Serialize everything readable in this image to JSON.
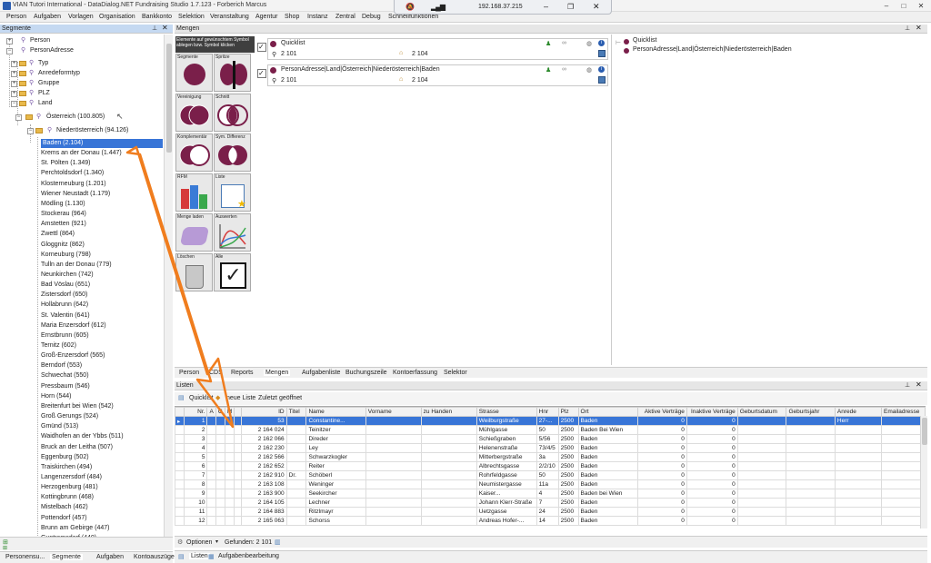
{
  "window": {
    "title": "VIAN Tutori International - DataDialog.NET Fundraising Studio 1.7.123 - Forberich Marcus"
  },
  "remote": {
    "ip": "192.168.37.215"
  },
  "menu": [
    "Person",
    "Aufgaben",
    "Vorlagen",
    "Organisation",
    "Bankkonto",
    "Selektion",
    "Veranstaltung",
    "Agentur",
    "Shop",
    "Instanz",
    "Zentral",
    "Debug",
    "Schnellfunktionen"
  ],
  "segmente": {
    "header": "Segmente",
    "root_items": [
      "Person",
      "PersonAdresse"
    ],
    "sub_items": [
      "Typ",
      "Anredeformtyp",
      "Gruppe",
      "PLZ",
      "Land"
    ],
    "country": "Österreich (100.805)",
    "state": "Niederösterreich (94.126)",
    "places": [
      "Baden (2.104)",
      "Krems an der Donau (1.447)",
      "St. Pölten (1.349)",
      "Perchtoldsdorf (1.340)",
      "Klosterneuburg (1.201)",
      "Wiener Neustadt (1.179)",
      "Mödling (1.130)",
      "Stockerau (964)",
      "Amstetten (921)",
      "Zwettl (864)",
      "Gloggnitz (862)",
      "Korneuburg (798)",
      "Tulln an der Donau (779)",
      "Neunkirchen (742)",
      "Bad Vöslau (651)",
      "Zistersdorf (650)",
      "Hollabrunn (642)",
      "St. Valentin (641)",
      "Maria Enzersdorf (612)",
      "Ernstbrunn (605)",
      "Ternitz (602)",
      "Groß-Enzersdorf (565)",
      "Berndorf (553)",
      "Schwechat (550)",
      "Pressbaum (546)",
      "Horn (544)",
      "Breitenfurt bei Wien (542)",
      "Groß Gerungs (524)",
      "Gmünd (513)",
      "Waidhofen an der Ybbs (511)",
      "Bruck an der Leitha (507)",
      "Eggenburg (502)",
      "Traiskirchen (494)",
      "Langenzersdorf (484)",
      "Herzogenburg (481)",
      "Kottingbrunn (468)",
      "Mistelbach (462)",
      "Pottendorf (457)",
      "Brunn am Gebirge (447)",
      "Guntramsdorf (440)"
    ]
  },
  "left_tabs": [
    "Personensu...",
    "Segmente",
    "Aufgaben",
    "Kontoauszüge"
  ],
  "mengen": {
    "header": "Mengen",
    "drop_hint": "Elemente auf gewünschtem Symbol ablegen bzw. Symbol klicken",
    "tools": [
      "Segmente",
      "Spritze",
      "Vereinigung",
      "Schnitt",
      "Komplementär",
      "Sym. Differenz",
      "RFM",
      "Liste",
      "Menge laden",
      "Auswerten",
      "Löschen",
      "Alle"
    ],
    "sets": [
      {
        "name": "Quicklist",
        "left_count": "2 101",
        "right_count": "2 104"
      },
      {
        "name": "PersonAdresse|Land|Österreich|Niederösterreich|Baden",
        "left_count": "2 101",
        "right_count": "2 104"
      }
    ],
    "tree_items": [
      "Quicklist",
      "PersonAdresse|Land|Österreich|Niederösterreich|Baden"
    ]
  },
  "modules": [
    "Person",
    "CDS",
    "Reports",
    "Mengen",
    "Aufgabenliste",
    "Buchungszeile",
    "Kontoerfassung",
    "Selektor"
  ],
  "listen": {
    "header": "Listen",
    "toolbar": [
      "Quicklist",
      "neue Liste",
      "Zuletzt geöffnet"
    ],
    "columns": [
      "Nr.",
      "A",
      "G",
      "M",
      "",
      "ID",
      "Titel",
      "Name",
      "Vorname",
      "zu Handen",
      "Strasse",
      "Hnr",
      "Plz",
      "Ort",
      "Aktive Verträge",
      "Inaktive Verträge",
      "Geburtsdatum",
      "Geburtsjahr",
      "Anrede",
      "Emailadresse"
    ],
    "rows": [
      {
        "nr": "1",
        "id": "53",
        "titel": "",
        "name": "Constantine...",
        "strasse": "Weilburgstraße",
        "hnr": "27-...",
        "plz": "2500",
        "ort": "Baden",
        "aktiv": "0",
        "inaktiv": "0",
        "anrede": "Herr"
      },
      {
        "nr": "2",
        "id": "2 164 024",
        "titel": "",
        "name": "Teinitzer",
        "strasse": "Mühlgasse",
        "hnr": "50",
        "plz": "2500",
        "ort": "Baden Bei Wien",
        "aktiv": "0",
        "inaktiv": "0",
        "anrede": ""
      },
      {
        "nr": "3",
        "id": "2 162 066",
        "titel": "",
        "name": "Direder",
        "strasse": "Schießgraben",
        "hnr": "5/56",
        "plz": "2500",
        "ort": "Baden",
        "aktiv": "0",
        "inaktiv": "0",
        "anrede": ""
      },
      {
        "nr": "4",
        "id": "2 162 230",
        "titel": "",
        "name": "Ley",
        "strasse": "Helenenstraße",
        "hnr": "73/4/5",
        "plz": "2500",
        "ort": "Baden",
        "aktiv": "0",
        "inaktiv": "0",
        "anrede": ""
      },
      {
        "nr": "5",
        "id": "2 162 566",
        "titel": "",
        "name": "Schwarzkogler",
        "strasse": "Mitterbergstraße",
        "hnr": "3a",
        "plz": "2500",
        "ort": "Baden",
        "aktiv": "0",
        "inaktiv": "0",
        "anrede": ""
      },
      {
        "nr": "6",
        "id": "2 162 652",
        "titel": "",
        "name": "Reiter",
        "strasse": "Albrechtsgasse",
        "hnr": "2/2/10",
        "plz": "2500",
        "ort": "Baden",
        "aktiv": "0",
        "inaktiv": "0",
        "anrede": ""
      },
      {
        "nr": "7",
        "id": "2 162 910",
        "titel": "Dr.",
        "name": "Schöberl",
        "strasse": "Rohrfeldgasse",
        "hnr": "50",
        "plz": "2500",
        "ort": "Baden",
        "aktiv": "0",
        "inaktiv": "0",
        "anrede": ""
      },
      {
        "nr": "8",
        "id": "2 163 108",
        "titel": "",
        "name": "Weninger",
        "strasse": "Neumistergasse",
        "hnr": "11a",
        "plz": "2500",
        "ort": "Baden",
        "aktiv": "0",
        "inaktiv": "0",
        "anrede": ""
      },
      {
        "nr": "9",
        "id": "2 163 900",
        "titel": "",
        "name": "Seekircher",
        "strasse": "Kaiser...",
        "hnr": "4",
        "plz": "2500",
        "ort": "Baden bei Wien",
        "aktiv": "0",
        "inaktiv": "0",
        "anrede": ""
      },
      {
        "nr": "10",
        "id": "2 164 105",
        "titel": "",
        "name": "Lechner",
        "strasse": "Johann Klerr-Straße",
        "hnr": "7",
        "plz": "2500",
        "ort": "Baden",
        "aktiv": "0",
        "inaktiv": "0",
        "anrede": ""
      },
      {
        "nr": "11",
        "id": "2 164 883",
        "titel": "",
        "name": "Ritzlmayr",
        "strasse": "Uetzgasse",
        "hnr": "24",
        "plz": "2500",
        "ort": "Baden",
        "aktiv": "0",
        "inaktiv": "0",
        "anrede": ""
      },
      {
        "nr": "12",
        "id": "2 165 063",
        "titel": "",
        "name": "Schorss",
        "strasse": "Andreas Hofer-...",
        "hnr": "14",
        "plz": "2500",
        "ort": "Baden",
        "aktiv": "0",
        "inaktiv": "0",
        "anrede": ""
      }
    ],
    "footer_options": "Optionen",
    "footer_found": "Gefunden: 2 101"
  },
  "bottom_tabs": [
    "Listen",
    "Aufgabenbearbeitung"
  ],
  "colors": {
    "selection": "#3875d7",
    "arrow": "#f07d1e",
    "set_icon": "#7a1f4a"
  }
}
